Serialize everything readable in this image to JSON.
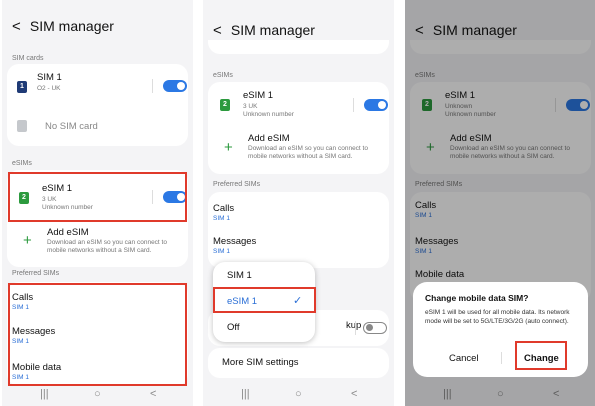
{
  "screen_title": "SIM manager",
  "back_glyph": "<",
  "nav": {
    "recent": "|||",
    "home": "○",
    "back": "<"
  },
  "panel1": {
    "sim_cards_header": "SIM cards",
    "sim1": {
      "icon": "1",
      "name": "SIM 1",
      "carrier": "O2 - UK"
    },
    "no_sim": "No SIM card",
    "esims_header": "eSIMs",
    "esim1": {
      "icon": "2",
      "name": "eSIM 1",
      "carrier": "3 UK",
      "number": "Unknown number"
    },
    "add_esim": {
      "title": "Add eSIM",
      "desc": "Download an eSIM so you can connect to mobile networks without a SIM card."
    },
    "preferred_header": "Preferred SIMs",
    "calls": {
      "label": "Calls",
      "value": "SIM 1"
    },
    "messages": {
      "label": "Messages",
      "value": "SIM 1"
    },
    "mobile_data": {
      "label": "Mobile data",
      "value": "SIM 1"
    }
  },
  "panel2": {
    "esims_header": "eSIMs",
    "esim1": {
      "icon": "2",
      "name": "eSIM 1",
      "carrier": "3 UK",
      "number": "Unknown number"
    },
    "add_esim": {
      "title": "Add eSIM",
      "desc": "Download an eSIM so you can connect to mobile networks without a SIM card."
    },
    "preferred_header": "Preferred SIMs",
    "calls": {
      "label": "Calls",
      "value": "SIM 1"
    },
    "messages": {
      "label": "Messages",
      "value": "SIM 1"
    },
    "backup_partial": "kup",
    "more_settings": "More SIM settings",
    "dropdown": {
      "options": [
        "SIM 1",
        "eSIM 1",
        "Off"
      ],
      "selected": "eSIM 1",
      "check": "✓"
    }
  },
  "panel3": {
    "esims_header": "eSIMs",
    "esim1": {
      "icon": "2",
      "name": "eSIM 1",
      "carrier": "Unknown",
      "number": "Unknown number"
    },
    "add_esim": {
      "title": "Add eSIM",
      "desc": "Download an eSIM so you can connect to mobile networks without a SIM card."
    },
    "preferred_header": "Preferred SIMs",
    "calls": {
      "label": "Calls",
      "value": "SIM 1"
    },
    "messages": {
      "label": "Messages",
      "value": "SIM 1"
    },
    "mobile_data": {
      "label": "Mobile data"
    },
    "dialog": {
      "title": "Change mobile data SIM?",
      "body": "eSIM 1 will be used for all mobile data. Its network mode will be set to 5G/LTE/3G/2G (auto connect).",
      "cancel": "Cancel",
      "confirm": "Change"
    }
  },
  "colors": {
    "accent": "#2b78e4",
    "highlight": "#e03a2b",
    "esim_green": "#2c9a3e",
    "sim_navy": "#1f3b76"
  }
}
